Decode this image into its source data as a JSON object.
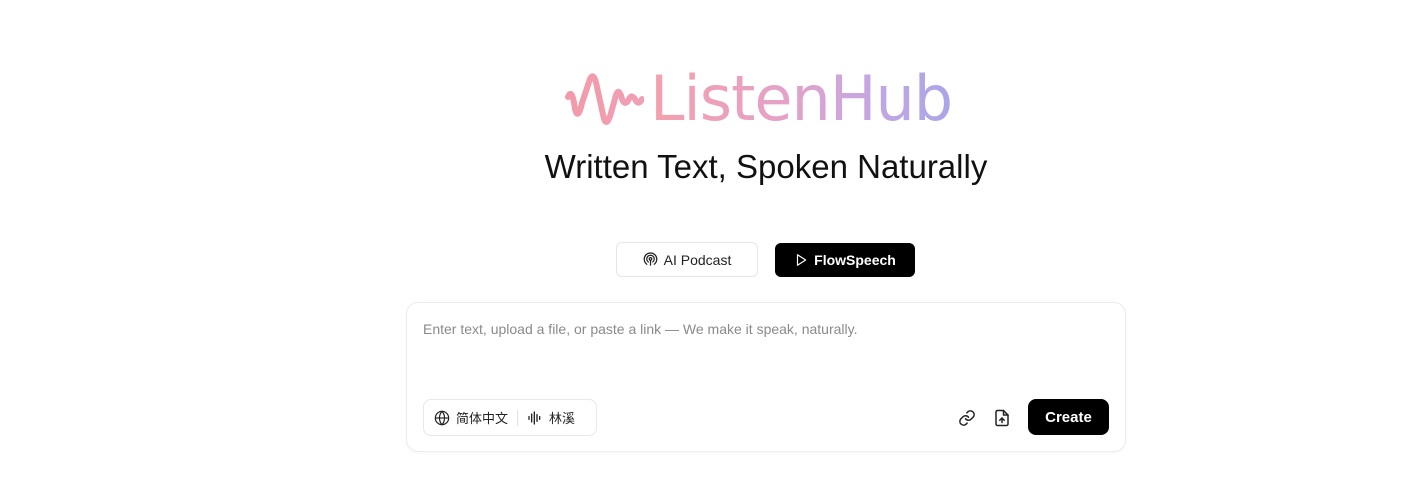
{
  "logo": {
    "text": "ListenHub"
  },
  "tagline": "Written Text, Spoken Naturally",
  "modes": {
    "podcast": {
      "label": "AI Podcast",
      "icon": "podcast-icon"
    },
    "flowspeech": {
      "label": "FlowSpeech",
      "icon": "play-icon",
      "active": true
    }
  },
  "editor": {
    "placeholder": "Enter text, upload a file, or paste a link — We make it speak, naturally.",
    "value": ""
  },
  "options": {
    "language": {
      "label": "简体中文",
      "icon": "globe-icon"
    },
    "voice": {
      "label": "林溪",
      "icon": "soundwave-icon"
    }
  },
  "actions": {
    "link_icon": "link-icon",
    "upload_icon": "upload-file-icon",
    "create_label": "Create"
  },
  "colors": {
    "logo_gradient_start": "#f4a0ad",
    "logo_gradient_end": "#a9a6ea",
    "primary": "#000000"
  }
}
